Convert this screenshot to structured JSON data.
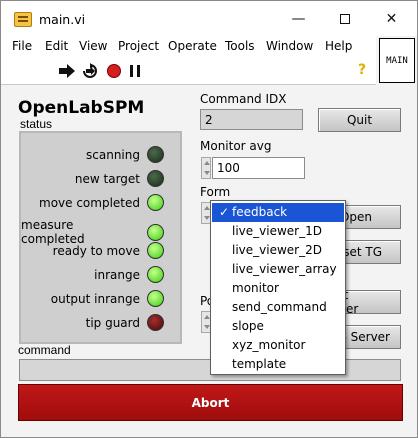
{
  "window": {
    "title": "main.vi",
    "minimize_glyph": "—",
    "close_glyph": "✕"
  },
  "menu": {
    "items": [
      "File",
      "Edit",
      "View",
      "Project",
      "Operate",
      "Tools",
      "Window",
      "Help"
    ]
  },
  "toolbar": {
    "icons": [
      "run-arrow-icon",
      "run-continuous-icon",
      "abort-stop-icon",
      "pause-icon"
    ],
    "help_glyph": "?",
    "vi_icon_label": "MAIN"
  },
  "panel": {
    "app_name": "OpenLabSPM",
    "status_label": "status",
    "leds": [
      {
        "label": "scanning",
        "state": "off"
      },
      {
        "label": "new target",
        "state": "off"
      },
      {
        "label": "move completed",
        "state": "on"
      },
      {
        "label": "measure completed",
        "state": "on"
      },
      {
        "label": "ready to move",
        "state": "on"
      },
      {
        "label": "inrange",
        "state": "on"
      },
      {
        "label": "output inrange",
        "state": "on"
      },
      {
        "label": "tip guard",
        "state": "red"
      }
    ],
    "command_idx_label": "Command IDX",
    "command_idx_value": "2",
    "quit_label": "Quit",
    "monitor_avg_label": "Monitor avg",
    "monitor_avg_value": "100",
    "form_label": "Form",
    "open_label": "Open",
    "reset_tg_label": "Reset TG",
    "port_label_partial": "Po",
    "start_server_label": "Start Server",
    "stop_server_label": "Stop Server",
    "command_label": "command",
    "command_value": "",
    "abort_label": "Abort"
  },
  "form_dropdown": {
    "check_glyph": "✓",
    "selected": "feedback",
    "options": [
      "feedback",
      "live_viewer_1D",
      "live_viewer_2D",
      "live_viewer_array",
      "monitor",
      "send_command",
      "slope",
      "xyz_monitor",
      "template"
    ]
  },
  "colors": {
    "led_on": "#38d00c",
    "led_off": "#1c2c1c",
    "led_red": "#4a0808",
    "abort_bg": "#b01010",
    "menu_highlight": "#1a55d6"
  }
}
